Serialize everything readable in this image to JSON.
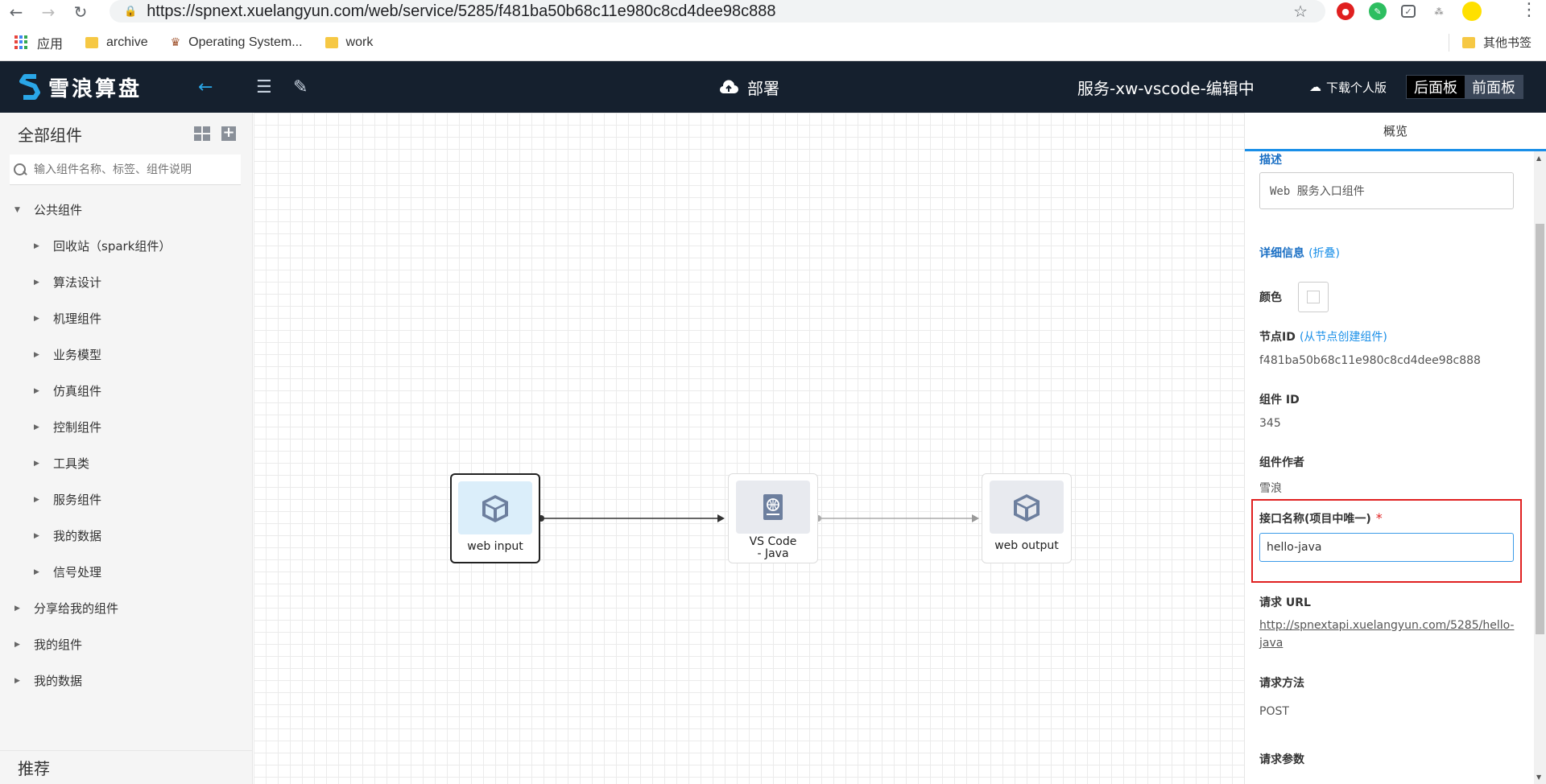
{
  "browser": {
    "url": "https://spnext.xuelangyun.com/web/service/5285/f481ba50b68c11e980c8cd4dee98c888",
    "bookmarks": [
      {
        "label": "应用"
      },
      {
        "label": "archive"
      },
      {
        "label": "Operating System..."
      },
      {
        "label": "work"
      }
    ],
    "other_bookmarks": "其他书签"
  },
  "header": {
    "logo_text": "雪浪算盘",
    "deploy_label": "部署",
    "service_title": "服务-xw-vscode-编辑中",
    "download_label": "下载个人版",
    "back_panel": "后面板",
    "front_panel": "前面板"
  },
  "sidebar": {
    "title": "全部组件",
    "search_placeholder": "输入组件名称、标签、组件说明",
    "tree": [
      {
        "label": "公共组件",
        "level": 0,
        "expanded": true
      },
      {
        "label": "回收站（spark组件）",
        "level": 1
      },
      {
        "label": "算法设计",
        "level": 1
      },
      {
        "label": "机理组件",
        "level": 1
      },
      {
        "label": "业务模型",
        "level": 1
      },
      {
        "label": "仿真组件",
        "level": 1
      },
      {
        "label": "控制组件",
        "level": 1
      },
      {
        "label": "工具类",
        "level": 1
      },
      {
        "label": "服务组件",
        "level": 1
      },
      {
        "label": "我的数据",
        "level": 1
      },
      {
        "label": "信号处理",
        "level": 1
      },
      {
        "label": "分享给我的组件",
        "level": 0
      },
      {
        "label": "我的组件",
        "level": 0
      },
      {
        "label": "我的数据",
        "level": 0
      }
    ],
    "footer": "推荐"
  },
  "canvas": {
    "nodes": [
      {
        "label": "web input",
        "icon": "cube-icon",
        "selected": true
      },
      {
        "label_line1": "VS Code",
        "label_line2": "- Java",
        "icon": "globe-book-icon"
      },
      {
        "label": "web output",
        "icon": "cube-icon"
      }
    ]
  },
  "panel": {
    "tab": "概览",
    "desc_label": "描述",
    "desc_value": "Web 服务入口组件",
    "detail_label": "详细信息",
    "detail_toggle": "(折叠)",
    "color_label": "颜色",
    "node_id_label": "节点ID",
    "node_id_link": "(从节点创建组件)",
    "node_id_value": "f481ba50b68c11e980c8cd4dee98c888",
    "comp_id_label": "组件 ID",
    "comp_id_value": "345",
    "author_label": "组件作者",
    "author_value": "雪浪",
    "api_name_label": "接口名称(项目中唯一)",
    "api_name_required": "*",
    "api_name_value": "hello-java",
    "req_url_label": "请求 URL",
    "req_url_line1": "http://spnextapi.xuelangyun.com/5285/hello-",
    "req_url_line2": "java",
    "method_label": "请求方法",
    "method_value": "POST",
    "params_label": "请求参数"
  },
  "colors": {
    "header_bg": "#15202e",
    "accent": "#1a8fe8",
    "highlight": "#e02020"
  }
}
